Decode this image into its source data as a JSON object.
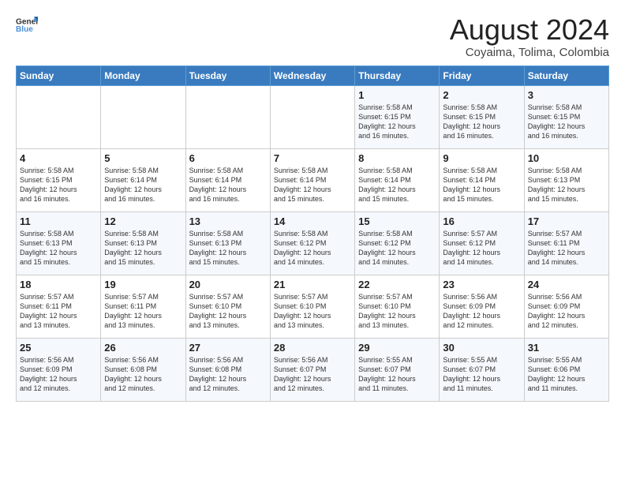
{
  "logo": {
    "general": "General",
    "blue": "Blue"
  },
  "header": {
    "month_year": "August 2024",
    "location": "Coyaima, Tolima, Colombia"
  },
  "days_of_week": [
    "Sunday",
    "Monday",
    "Tuesday",
    "Wednesday",
    "Thursday",
    "Friday",
    "Saturday"
  ],
  "weeks": [
    [
      {
        "num": "",
        "detail": ""
      },
      {
        "num": "",
        "detail": ""
      },
      {
        "num": "",
        "detail": ""
      },
      {
        "num": "",
        "detail": ""
      },
      {
        "num": "1",
        "detail": "Sunrise: 5:58 AM\nSunset: 6:15 PM\nDaylight: 12 hours\nand 16 minutes."
      },
      {
        "num": "2",
        "detail": "Sunrise: 5:58 AM\nSunset: 6:15 PM\nDaylight: 12 hours\nand 16 minutes."
      },
      {
        "num": "3",
        "detail": "Sunrise: 5:58 AM\nSunset: 6:15 PM\nDaylight: 12 hours\nand 16 minutes."
      }
    ],
    [
      {
        "num": "4",
        "detail": "Sunrise: 5:58 AM\nSunset: 6:15 PM\nDaylight: 12 hours\nand 16 minutes."
      },
      {
        "num": "5",
        "detail": "Sunrise: 5:58 AM\nSunset: 6:14 PM\nDaylight: 12 hours\nand 16 minutes."
      },
      {
        "num": "6",
        "detail": "Sunrise: 5:58 AM\nSunset: 6:14 PM\nDaylight: 12 hours\nand 16 minutes."
      },
      {
        "num": "7",
        "detail": "Sunrise: 5:58 AM\nSunset: 6:14 PM\nDaylight: 12 hours\nand 15 minutes."
      },
      {
        "num": "8",
        "detail": "Sunrise: 5:58 AM\nSunset: 6:14 PM\nDaylight: 12 hours\nand 15 minutes."
      },
      {
        "num": "9",
        "detail": "Sunrise: 5:58 AM\nSunset: 6:14 PM\nDaylight: 12 hours\nand 15 minutes."
      },
      {
        "num": "10",
        "detail": "Sunrise: 5:58 AM\nSunset: 6:13 PM\nDaylight: 12 hours\nand 15 minutes."
      }
    ],
    [
      {
        "num": "11",
        "detail": "Sunrise: 5:58 AM\nSunset: 6:13 PM\nDaylight: 12 hours\nand 15 minutes."
      },
      {
        "num": "12",
        "detail": "Sunrise: 5:58 AM\nSunset: 6:13 PM\nDaylight: 12 hours\nand 15 minutes."
      },
      {
        "num": "13",
        "detail": "Sunrise: 5:58 AM\nSunset: 6:13 PM\nDaylight: 12 hours\nand 15 minutes."
      },
      {
        "num": "14",
        "detail": "Sunrise: 5:58 AM\nSunset: 6:12 PM\nDaylight: 12 hours\nand 14 minutes."
      },
      {
        "num": "15",
        "detail": "Sunrise: 5:58 AM\nSunset: 6:12 PM\nDaylight: 12 hours\nand 14 minutes."
      },
      {
        "num": "16",
        "detail": "Sunrise: 5:57 AM\nSunset: 6:12 PM\nDaylight: 12 hours\nand 14 minutes."
      },
      {
        "num": "17",
        "detail": "Sunrise: 5:57 AM\nSunset: 6:11 PM\nDaylight: 12 hours\nand 14 minutes."
      }
    ],
    [
      {
        "num": "18",
        "detail": "Sunrise: 5:57 AM\nSunset: 6:11 PM\nDaylight: 12 hours\nand 13 minutes."
      },
      {
        "num": "19",
        "detail": "Sunrise: 5:57 AM\nSunset: 6:11 PM\nDaylight: 12 hours\nand 13 minutes."
      },
      {
        "num": "20",
        "detail": "Sunrise: 5:57 AM\nSunset: 6:10 PM\nDaylight: 12 hours\nand 13 minutes."
      },
      {
        "num": "21",
        "detail": "Sunrise: 5:57 AM\nSunset: 6:10 PM\nDaylight: 12 hours\nand 13 minutes."
      },
      {
        "num": "22",
        "detail": "Sunrise: 5:57 AM\nSunset: 6:10 PM\nDaylight: 12 hours\nand 13 minutes."
      },
      {
        "num": "23",
        "detail": "Sunrise: 5:56 AM\nSunset: 6:09 PM\nDaylight: 12 hours\nand 12 minutes."
      },
      {
        "num": "24",
        "detail": "Sunrise: 5:56 AM\nSunset: 6:09 PM\nDaylight: 12 hours\nand 12 minutes."
      }
    ],
    [
      {
        "num": "25",
        "detail": "Sunrise: 5:56 AM\nSunset: 6:09 PM\nDaylight: 12 hours\nand 12 minutes."
      },
      {
        "num": "26",
        "detail": "Sunrise: 5:56 AM\nSunset: 6:08 PM\nDaylight: 12 hours\nand 12 minutes."
      },
      {
        "num": "27",
        "detail": "Sunrise: 5:56 AM\nSunset: 6:08 PM\nDaylight: 12 hours\nand 12 minutes."
      },
      {
        "num": "28",
        "detail": "Sunrise: 5:56 AM\nSunset: 6:07 PM\nDaylight: 12 hours\nand 12 minutes."
      },
      {
        "num": "29",
        "detail": "Sunrise: 5:55 AM\nSunset: 6:07 PM\nDaylight: 12 hours\nand 11 minutes."
      },
      {
        "num": "30",
        "detail": "Sunrise: 5:55 AM\nSunset: 6:07 PM\nDaylight: 12 hours\nand 11 minutes."
      },
      {
        "num": "31",
        "detail": "Sunrise: 5:55 AM\nSunset: 6:06 PM\nDaylight: 12 hours\nand 11 minutes."
      }
    ]
  ]
}
